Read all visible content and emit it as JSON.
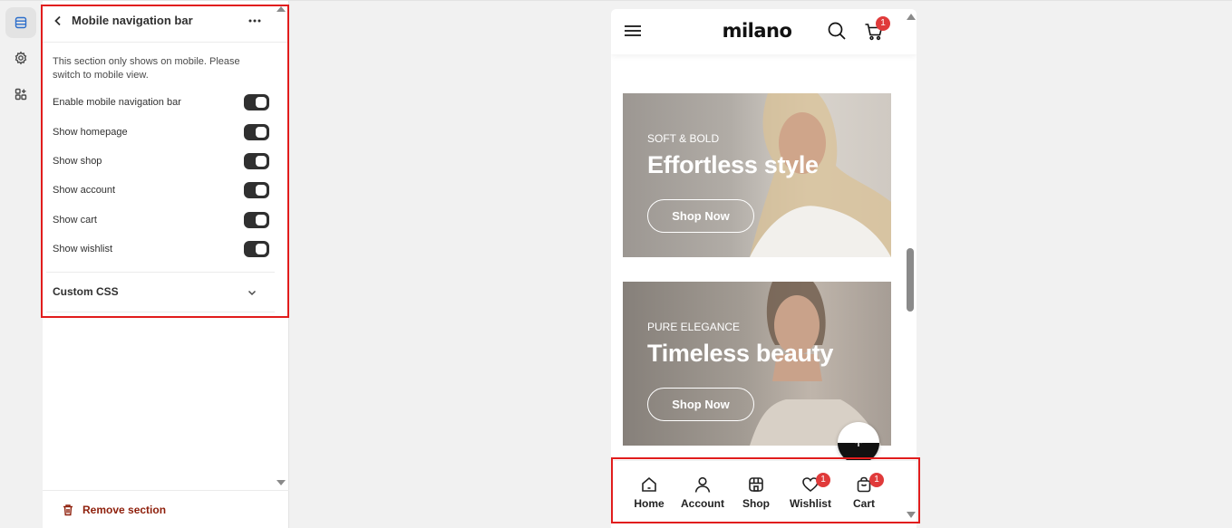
{
  "rail": {
    "items": [
      {
        "icon": "sections-icon",
        "active": true
      },
      {
        "icon": "gear-icon",
        "active": false
      },
      {
        "icon": "apps-icon",
        "active": false
      }
    ]
  },
  "panel": {
    "title": "Mobile navigation bar",
    "info": "This section only shows on mobile. Please switch to mobile view.",
    "toggles": [
      {
        "label": "Enable mobile navigation bar",
        "on": true
      },
      {
        "label": "Show homepage",
        "on": true
      },
      {
        "label": "Show shop",
        "on": true
      },
      {
        "label": "Show account",
        "on": true
      },
      {
        "label": "Show cart",
        "on": true
      },
      {
        "label": "Show wishlist",
        "on": true
      }
    ],
    "custom_css_label": "Custom CSS",
    "remove_label": "Remove section"
  },
  "preview": {
    "logo": "milano",
    "cart_count": "1",
    "banners": [
      {
        "tag": "SOFT & BOLD",
        "title": "Effortless style",
        "button": "Shop Now"
      },
      {
        "tag": "PURE ELEGANCE",
        "title": "Timeless beauty",
        "button": "Shop Now"
      }
    ],
    "nav": [
      {
        "label": "Home",
        "icon": "home-icon"
      },
      {
        "label": "Account",
        "icon": "user-icon"
      },
      {
        "label": "Shop",
        "icon": "shop-icon"
      },
      {
        "label": "Wishlist",
        "icon": "heart-icon",
        "badge": "1"
      },
      {
        "label": "Cart",
        "icon": "bag-icon",
        "badge": "1"
      }
    ]
  },
  "colors": {
    "highlight": "#e11d1d",
    "badge": "#e03a3a",
    "toggle_on": "#303030",
    "remove": "#8e1f0b"
  }
}
